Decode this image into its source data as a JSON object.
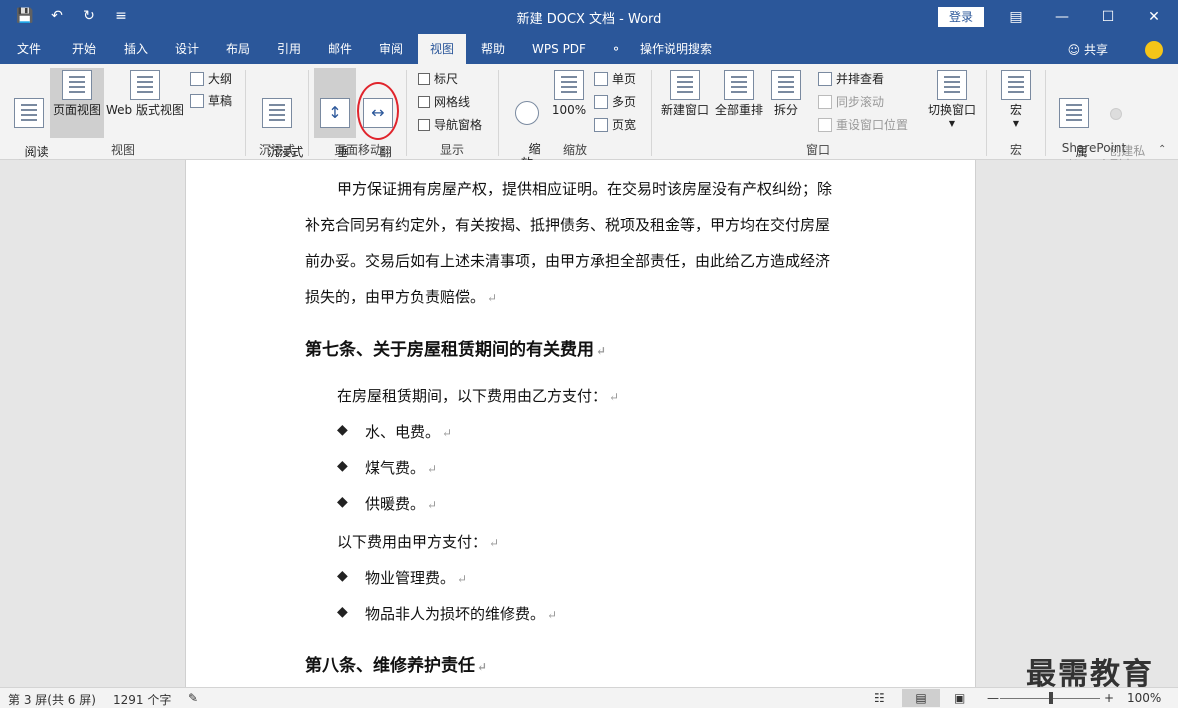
{
  "titlebar": {
    "title": "新建 DOCX 文档  -  Word",
    "login": "登录",
    "qat_icons": [
      "save-icon",
      "undo-icon",
      "redo-icon",
      "customize-icon"
    ]
  },
  "tabs": [
    {
      "label": "文件"
    },
    {
      "label": "开始"
    },
    {
      "label": "插入"
    },
    {
      "label": "设计"
    },
    {
      "label": "布局"
    },
    {
      "label": "引用"
    },
    {
      "label": "邮件"
    },
    {
      "label": "审阅"
    },
    {
      "label": "视图"
    },
    {
      "label": "帮助"
    },
    {
      "label": "WPS PDF"
    },
    {
      "label": "操作说明搜索"
    }
  ],
  "share": "共享",
  "ribbon": {
    "view_group": {
      "label": "视图",
      "read": "阅读\n视图",
      "print": "页面视图",
      "web": "Web 版式视图",
      "outline": "大纲",
      "draft": "草稿"
    },
    "immersive_group": {
      "label": "沉浸式",
      "reader": "沉浸式\n阅读器"
    },
    "pagemove_group": {
      "label": "页面移动",
      "vertical": "垂\n直",
      "flip": "翻\n页"
    },
    "show_group": {
      "label": "显示",
      "ruler": "标尺",
      "grid": "网格线",
      "nav": "导航窗格"
    },
    "zoom_group": {
      "label": "缩放",
      "zoom": "缩\n放",
      "pct": "100%",
      "single": "单页",
      "multi": "多页",
      "width": "页宽"
    },
    "window_group": {
      "label": "窗口",
      "new_win": "新建窗口",
      "arrange": "全部重排",
      "split": "拆分",
      "side": "并排查看",
      "sync": "同步滚动",
      "reset": "重设窗口位置",
      "switch": "切换窗口"
    },
    "macro_group": {
      "label": "宏",
      "macro": "宏"
    },
    "sharepoint_group": {
      "label": "SharePoint",
      "props": "属\n性",
      "private": "创建私\n人副本"
    }
  },
  "document": {
    "para1": [
      "甲方保证拥有房屋产权，提供相应证明。在交易时该房屋没有产权纠纷；除",
      "补充合同另有约定外，有关按揭、抵押债务、税项及租金等，甲方均在交付房屋",
      "前办妥。交易后如有上述未清事项，由甲方承担全部责任，由此给乙方造成经济",
      "损失的，由甲方负责赔偿。"
    ],
    "heading7": "第七条、关于房屋租赁期间的有关费用",
    "intro_b": "在房屋租赁期间，以下费用由乙方支付：",
    "list_b": [
      "水、电费。",
      "煤气费。",
      "供暖费。"
    ],
    "intro_a": "以下费用由甲方支付：",
    "list_a": [
      "物业管理费。",
      "物品非人为损坏的维修费。"
    ],
    "heading8": "第八条、维修养护责任",
    "bullet": "◆",
    "para_mark": "↵"
  },
  "status": {
    "page": "第 3 屏(共 6 屏)",
    "words": "1291 个字",
    "zoom": "100%"
  },
  "watermark": "最需教育"
}
